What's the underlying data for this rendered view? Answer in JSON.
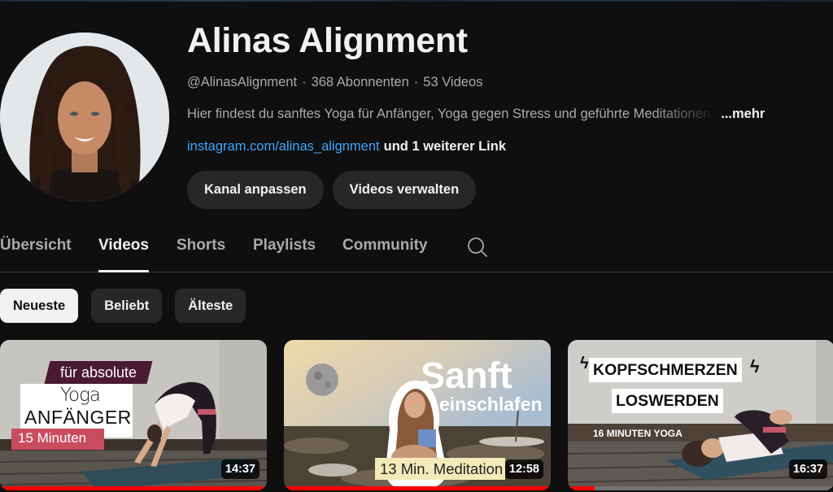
{
  "channel": {
    "name": "Alinas Alignment",
    "handle": "@AlinasAlignment",
    "subscribers": "368 Abonnenten",
    "video_count": "53 Videos",
    "meta_separator": "·",
    "description": "Hier findest du sanftes Yoga für Anfänger, Yoga gegen Stress und geführte Meditationen f",
    "description_more": "...mehr",
    "link": "instagram.com/alinas_alignment",
    "more_links": "und 1 weiterer Link",
    "avatar_icon": "channel-avatar"
  },
  "header_buttons": {
    "customize": "Kanal anpassen",
    "manage_videos": "Videos verwalten"
  },
  "tabs": [
    {
      "label": "Übersicht",
      "active": false
    },
    {
      "label": "Videos",
      "active": true
    },
    {
      "label": "Shorts",
      "active": false
    },
    {
      "label": "Playlists",
      "active": false
    },
    {
      "label": "Community",
      "active": false
    }
  ],
  "tab_search_icon": "search-icon",
  "sort_chips": [
    {
      "label": "Neueste",
      "selected": true
    },
    {
      "label": "Beliebt",
      "selected": false
    },
    {
      "label": "Älteste",
      "selected": false
    }
  ],
  "videos": [
    {
      "duration": "14:37",
      "watch_progress": 1.0,
      "thumbnail_text": {
        "line1": "für absolute",
        "line2": "Yoga",
        "line3": "ANFÄNGER",
        "line4": "15 Minuten"
      }
    },
    {
      "duration": "12:58",
      "watch_progress": 1.0,
      "thumbnail_text": {
        "line1": "Sanft",
        "line2": "einschlafen",
        "line3": "13 Min. Meditation"
      }
    },
    {
      "duration": "16:37",
      "watch_progress": 0.1,
      "thumbnail_text": {
        "line1": "KOPFSCHMERZEN",
        "line2": "LOSWERDEN",
        "line3": "16 MINUTEN YOGA"
      }
    }
  ],
  "colors": {
    "background": "#0f0f0f",
    "link": "#3ea6ff",
    "progress": "#ff0000",
    "button": "#272727"
  }
}
